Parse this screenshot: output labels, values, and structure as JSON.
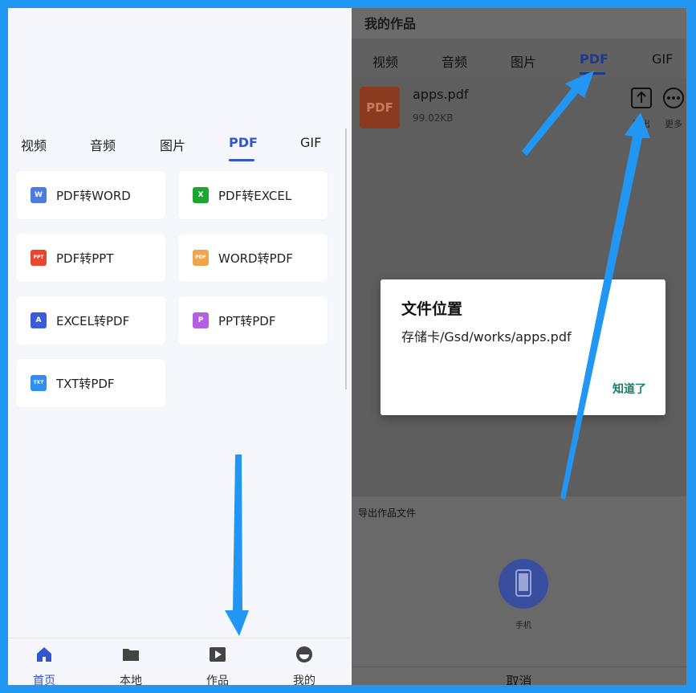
{
  "left": {
    "tabs": [
      "视频",
      "音频",
      "图片",
      "PDF",
      "GIF"
    ],
    "active_tab": "PDF",
    "tools": [
      {
        "label": "PDF转WORD",
        "icon": "word-icon",
        "icon_text": "W",
        "color": "#4a7ce2"
      },
      {
        "label": "PDF转EXCEL",
        "icon": "excel-icon",
        "icon_text": "X",
        "color": "#1da532"
      },
      {
        "label": "PDF转PPT",
        "icon": "ppt-icon",
        "icon_text": "PPT",
        "color": "#e8472e"
      },
      {
        "label": "WORD转PDF",
        "icon": "pdf-icon",
        "icon_text": "PDF",
        "color": "#f0a54a"
      },
      {
        "label": "EXCEL转PDF",
        "icon": "acrobat-icon",
        "icon_text": "A",
        "color": "#3c5bd6"
      },
      {
        "label": "PPT转PDF",
        "icon": "ppt-pdf-icon",
        "icon_text": "P",
        "color": "#b360e4"
      },
      {
        "label": "TXT转PDF",
        "icon": "txt-icon",
        "icon_text": "TXT",
        "color": "#2f8ff0"
      }
    ],
    "bottom_nav": [
      {
        "label": "首页",
        "icon": "home-icon",
        "active": true
      },
      {
        "label": "本地",
        "icon": "folder-icon",
        "active": false
      },
      {
        "label": "作品",
        "icon": "play-icon",
        "active": false
      },
      {
        "label": "我的",
        "icon": "profile-icon",
        "active": false
      }
    ]
  },
  "right": {
    "header_title": "我的作品",
    "tabs": [
      "视频",
      "音频",
      "图片",
      "PDF",
      "GIF"
    ],
    "active_tab": "PDF",
    "file": {
      "icon_text": "PDF",
      "name": "apps.pdf",
      "size": "99.02KB"
    },
    "actions": [
      {
        "label": "导出",
        "icon": "export-icon"
      },
      {
        "label": "更多",
        "icon": "more-icon"
      }
    ],
    "sheet": {
      "title": "导出作品文件",
      "option_label": "手机",
      "cancel": "取消"
    }
  },
  "dialog": {
    "title": "文件位置",
    "message": "存储卡/Gsd/works/apps.pdf",
    "button": "知道了"
  },
  "colors": {
    "frame_border": "#2196f3",
    "accent": "#3056d3",
    "dialog_button": "#14806a",
    "arrow": "#2196f3"
  }
}
